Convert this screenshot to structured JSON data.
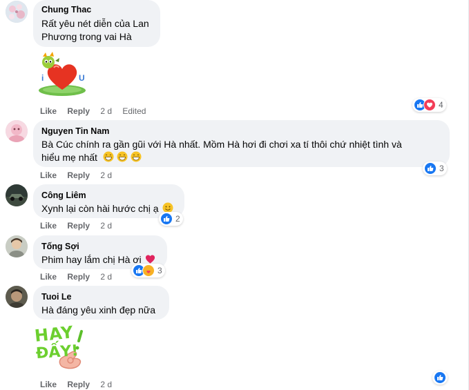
{
  "comments": [
    {
      "author": "Chung Thac",
      "lines": [
        "Rất yêu nét diễn của Lan",
        "Phương trong vai Hà"
      ],
      "actions": {
        "like": "Like",
        "reply": "Reply",
        "time": "2 d",
        "edited": "Edited"
      },
      "reaction_count": "4"
    },
    {
      "author": "Nguyen Tin Nam",
      "lines": [
        "Bà Cúc chính ra gần gũi với Hà nhất. Mồm Hà hơi đi chơi xa tí thôi chứ nhiệt tình và",
        "hiểu mẹ nhất"
      ],
      "actions": {
        "like": "Like",
        "reply": "Reply",
        "time": "2 d"
      },
      "reaction_count": "3"
    },
    {
      "author": "Công Liêm",
      "lines": [
        "Xynh lại còn hài hước chị ạ"
      ],
      "actions": {
        "like": "Like",
        "reply": "Reply",
        "time": "2 d"
      },
      "reaction_count": "2"
    },
    {
      "author": "Tống Sợi",
      "lines": [
        "Phim hay lắm chị Hà ơi"
      ],
      "actions": {
        "like": "Like",
        "reply": "Reply",
        "time": "2 d"
      },
      "reaction_count": "3"
    },
    {
      "author": "Tuoi Le",
      "lines": [
        "Hà đáng yêu xinh đẹp nữa"
      ],
      "actions": {
        "like": "Like",
        "reply": "Reply",
        "time": "2 d"
      },
      "sticker_text": [
        "HAY",
        "ĐẤY!"
      ]
    }
  ],
  "stickers": {
    "heart_letters": [
      "i",
      "U"
    ]
  },
  "colors": {
    "bubble": "#f0f2f5",
    "like_blue": "#1877f2",
    "love_red": "#f33e58",
    "meta_gray": "#65676b"
  }
}
